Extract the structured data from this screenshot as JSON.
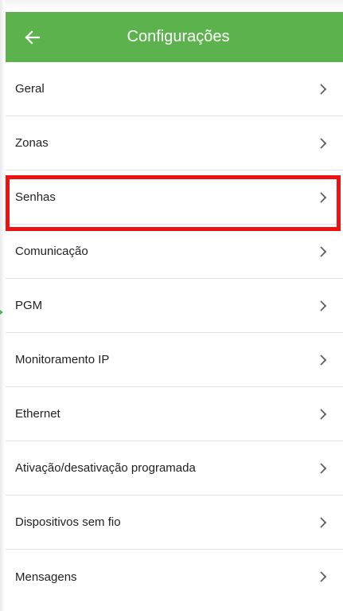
{
  "appbar": {
    "title": "Configurações",
    "color": "#5cb34d",
    "back_icon": "arrow-left-icon"
  },
  "highlight_color": "#ee1111",
  "settings": {
    "chevron_icon": "chevron-right-icon",
    "items": [
      {
        "label": "Geral"
      },
      {
        "label": "Zonas"
      },
      {
        "label": "Senhas"
      },
      {
        "label": "Comunicação"
      },
      {
        "label": "PGM"
      },
      {
        "label": "Monitoramento IP"
      },
      {
        "label": "Ethernet"
      },
      {
        "label": "Ativação/desativação programada"
      },
      {
        "label": "Dispositivos sem fio"
      },
      {
        "label": "Mensagens"
      }
    ]
  }
}
